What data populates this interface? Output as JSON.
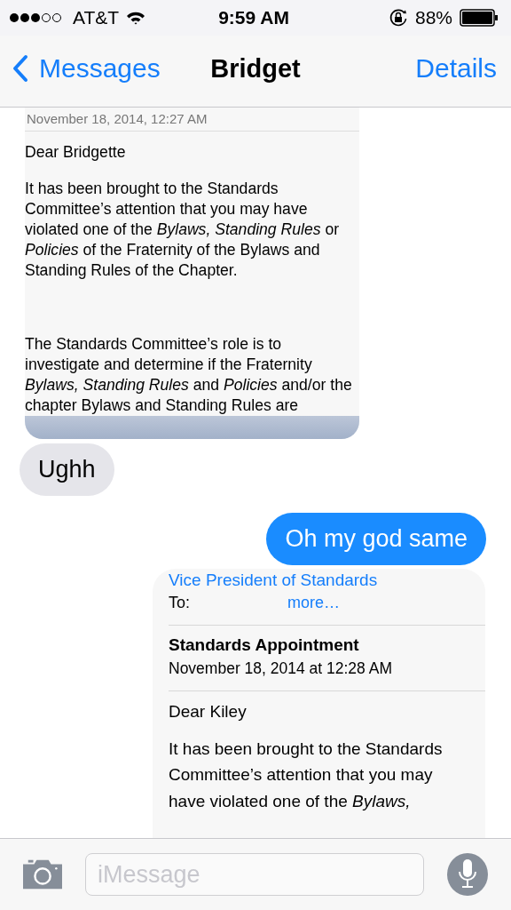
{
  "status_bar": {
    "carrier": "AT&T",
    "time": "9:59 AM",
    "battery": "88%"
  },
  "nav": {
    "back": "Messages",
    "title": "Bridget",
    "action": "Details"
  },
  "messages": [
    {
      "kind": "screenshot",
      "outgoing": false,
      "date": "November 18, 2014, 12:27 AM",
      "paragraphs": [
        "Dear Bridgette",
        "It has been brought to the Standards Committee’s attention that you may have violated one of the *Bylaws, Standing Rules* or *Policies* of the Fraternity of the Bylaws and Standing Rules of the Chapter.",
        "The Standards Committee’s role is to investigate and determine if the Fraternity *Bylaws, Standing Rules* and *Policies* and/or the chapter Bylaws and Standing Rules are"
      ]
    },
    {
      "kind": "text",
      "outgoing": false,
      "text": "Ughh"
    },
    {
      "kind": "text",
      "outgoing": true,
      "text": "Oh my god same"
    },
    {
      "kind": "screenshot",
      "outgoing": true,
      "from": "Vice President of Standards",
      "to_label": "To:",
      "more": "more…",
      "subject": "Standards Appointment",
      "date": "November 18, 2014 at 12:28 AM",
      "paragraphs": [
        "Dear Kiley",
        "It has been brought to the Standards Committee’s attention that you may have violated one of the *Bylaws,*"
      ]
    }
  ],
  "composer": {
    "placeholder": "iMessage"
  }
}
